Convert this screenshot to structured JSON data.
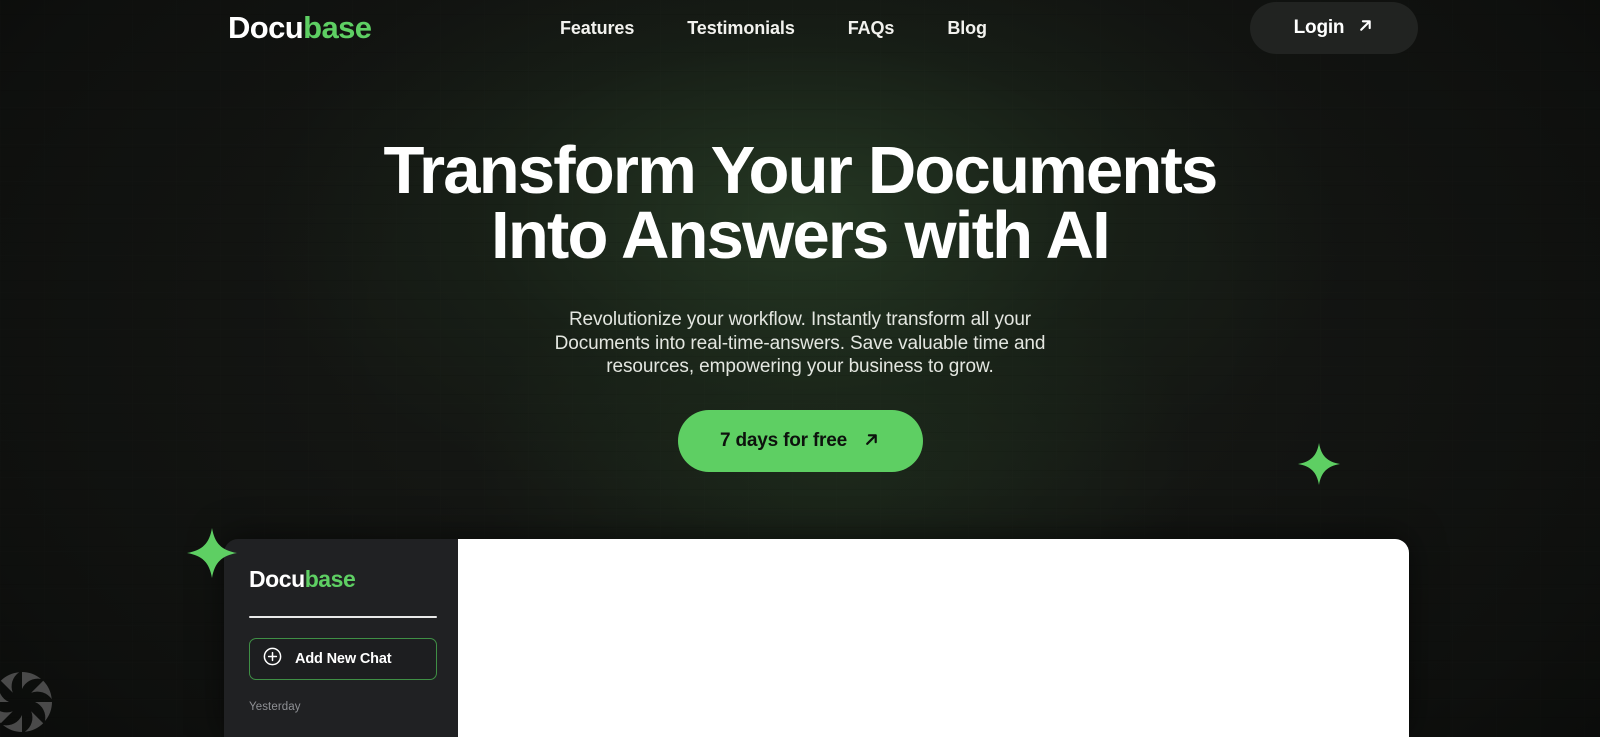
{
  "brand": {
    "name_prefix": "Docu",
    "name_suffix": "base",
    "accent_color": "#5ecf63",
    "background_color": "#141613"
  },
  "header": {
    "nav_items": [
      {
        "label": "Features"
      },
      {
        "label": "Testimonials"
      },
      {
        "label": "FAQs"
      },
      {
        "label": "Blog"
      }
    ],
    "login": {
      "label": "Login",
      "icon": "arrow-up-right-icon"
    }
  },
  "hero": {
    "title_line_1": "Transform Your Documents",
    "title_line_2": "Into Answers with AI",
    "subtitle_line_1": "Revolutionize your workflow. Instantly transform all your",
    "subtitle_line_2": "Documents into real-time-answers. Save valuable time and",
    "subtitle_line_3": "resources, empowering your business to grow.",
    "cta": {
      "label": "7 days for free",
      "icon": "arrow-up-right-icon",
      "background_color": "#5ecf63",
      "text_color": "#0d120d"
    }
  },
  "app_preview": {
    "sidebar": {
      "logo_prefix": "Docu",
      "logo_suffix": "base",
      "add_chat": {
        "label": "Add New Chat",
        "icon": "plus-circle-icon",
        "border_color": "#3f8f45"
      },
      "history_group_label": "Yesterday",
      "background_color": "#202123"
    },
    "main_panel": {
      "background_color": "#ffffff"
    }
  },
  "decorations": {
    "sparkle_left": "sparkle-star-icon",
    "sparkle_right": "sparkle-star-icon",
    "corner_ornament": "flower-spiral-icon"
  }
}
